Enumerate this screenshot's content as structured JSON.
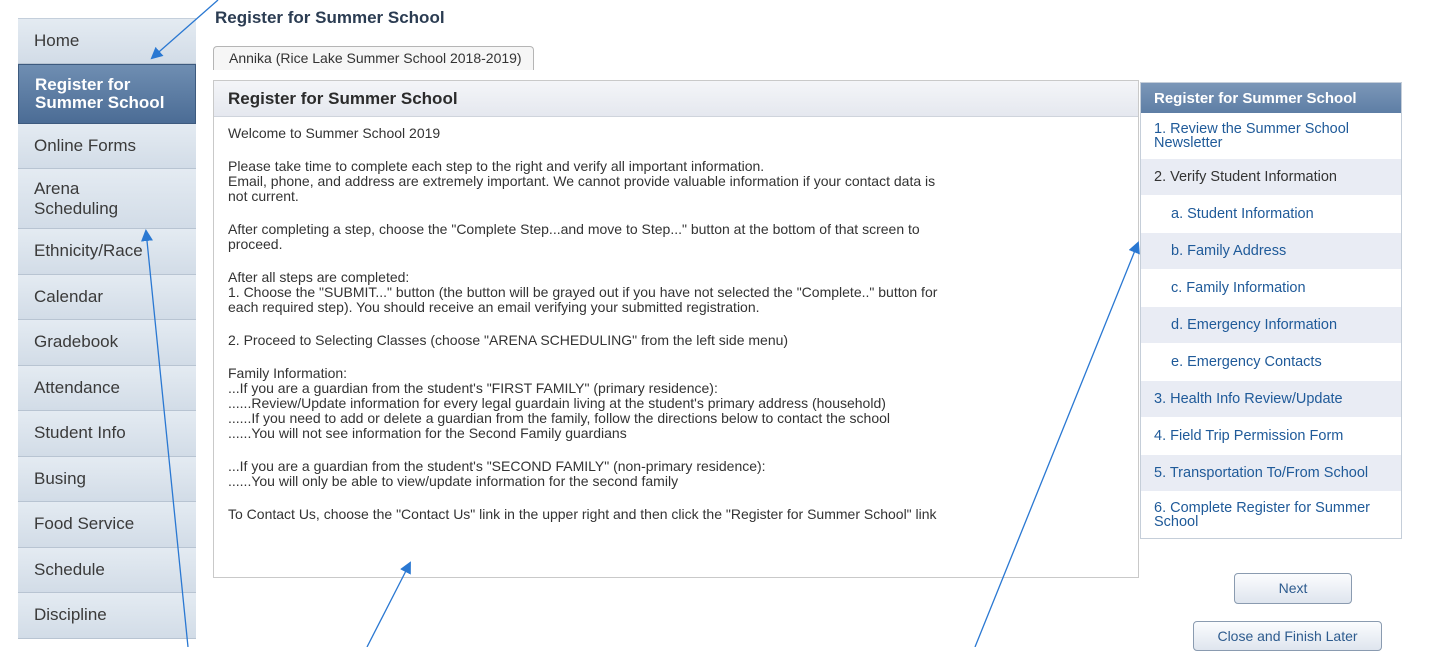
{
  "page_title": "Register for Summer School",
  "tab_label": "Annika (Rice Lake Summer School 2018-2019)",
  "sidebar": {
    "items": [
      {
        "label": "Home"
      },
      {
        "label": "Register for Summer School"
      },
      {
        "label": "Online Forms"
      },
      {
        "label": "Arena Scheduling"
      },
      {
        "label": "Ethnicity/Race"
      },
      {
        "label": "Calendar"
      },
      {
        "label": "Gradebook"
      },
      {
        "label": "Attendance"
      },
      {
        "label": "Student Info"
      },
      {
        "label": "Busing"
      },
      {
        "label": "Food Service"
      },
      {
        "label": "Schedule"
      },
      {
        "label": "Discipline"
      }
    ],
    "active_index": 1
  },
  "main": {
    "header": "Register for Summer School",
    "paragraphs": [
      "Welcome to Summer School 2019",
      "Please take time to complete each step to the right and verify all important information.\nEmail, phone, and address are extremely important. We cannot provide valuable information if your contact data is\nnot current.",
      "After completing a step, choose the \"Complete Step...and move to Step...\" button at the bottom of that screen to\nproceed.",
      "After all steps are completed:\n1. Choose the \"SUBMIT...\" button (the button will be grayed out if you have not selected the \"Complete..\" button for\neach required step). You should receive an email verifying your submitted registration.",
      "2. Proceed to Selecting Classes (choose \"ARENA SCHEDULING\" from the left side menu)",
      "Family Information:\n...If you are a guardian from the student's \"FIRST FAMILY\" (primary residence):\n......Review/Update information for every legal guardain living at the student's primary address (household)\n......If you need to add or delete a guardian from the family, follow the directions below to contact the school\n......You will not see information for the Second Family guardians",
      "...If you are a guardian from the student's \"SECOND FAMILY\" (non-primary residence):\n......You will only be able to view/update information for the second family",
      "To Contact Us, choose the \"Contact Us\" link in the upper right and then click the \"Register for Summer School\" link"
    ]
  },
  "steps": {
    "header": "Register for Summer School",
    "items": [
      {
        "label": "1. Review the Summer School Newsletter"
      },
      {
        "label": "2. Verify Student Information"
      },
      {
        "label": "a. Student Information"
      },
      {
        "label": "b. Family Address"
      },
      {
        "label": "c. Family Information"
      },
      {
        "label": "d. Emergency Information"
      },
      {
        "label": "e. Emergency Contacts"
      },
      {
        "label": "3. Health Info Review/Update"
      },
      {
        "label": "4. Field Trip Permission Form"
      },
      {
        "label": "5. Transportation To/From School"
      },
      {
        "label": "6. Complete Register for Summer School"
      }
    ]
  },
  "buttons": {
    "next": "Next",
    "close": "Close and Finish Later"
  },
  "colors": {
    "accent": "#4b6c95",
    "link": "#1f5a99",
    "annotation_arrows": "#2a78d2"
  }
}
